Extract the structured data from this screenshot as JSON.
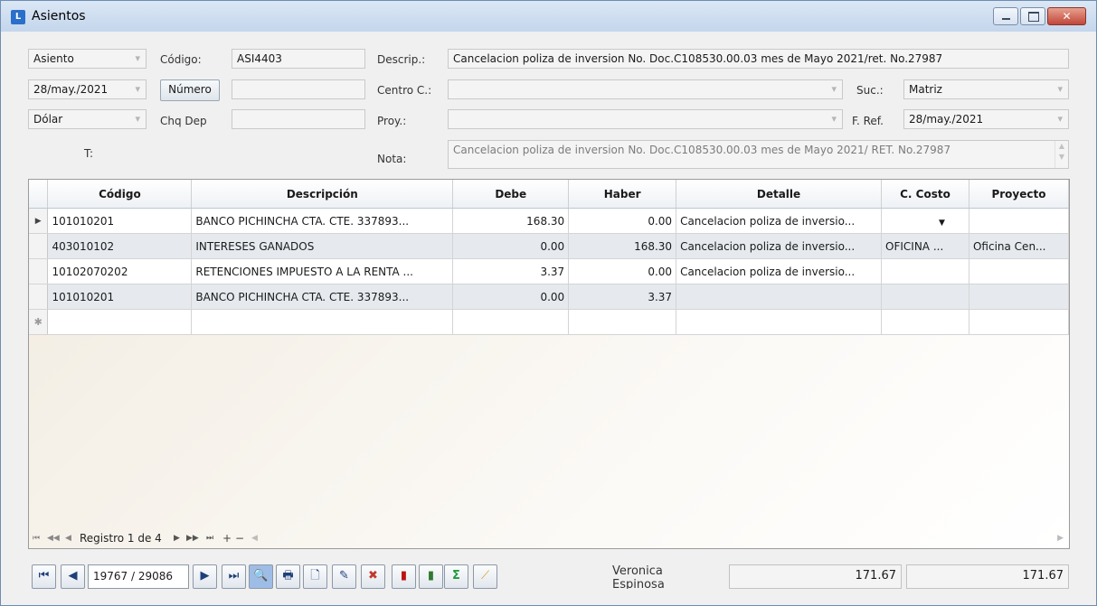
{
  "window": {
    "title": "Asientos",
    "close_glyph": "✕"
  },
  "header": {
    "type_value": "Asiento",
    "codigo_label": "Código:",
    "codigo_value": "ASI4403",
    "descrip_label": "Descrip.:",
    "descrip_value": "Cancelacion poliza de inversion No. Doc.C108530.00.03 mes de Mayo 2021/ret. No.27987",
    "date_value": "28/may./2021",
    "numero_button": "Número",
    "numero_value": "",
    "centro_label": "Centro C.:",
    "centro_value": "",
    "suc_label": "Suc.:",
    "suc_value": "Matriz",
    "currency_value": "Dólar",
    "chq_label": "Chq Dep",
    "chq_value": "",
    "proy_label": "Proy.:",
    "proy_value": "",
    "fref_label": "F. Ref.",
    "fref_value": "28/may./2021",
    "t_label": "T:",
    "nota_label": "Nota:",
    "nota_value": "Cancelacion poliza de inversion No. Doc.C108530.00.03 mes de Mayo 2021/ RET. No.27987"
  },
  "grid": {
    "columns": [
      "Código",
      "Descripción",
      "Debe",
      "Haber",
      "Detalle",
      "C. Costo",
      "Proyecto"
    ],
    "rows": [
      {
        "codigo": "101010201",
        "descripcion": "BANCO PICHINCHA CTA. CTE. 337893...",
        "debe": "168.30",
        "haber": "0.00",
        "detalle": "Cancelacion poliza de inversio...",
        "costo": "",
        "proyecto": ""
      },
      {
        "codigo": "403010102",
        "descripcion": "INTERESES GANADOS",
        "debe": "0.00",
        "haber": "168.30",
        "detalle": "Cancelacion poliza de inversio...",
        "costo": "OFICINA ...",
        "proyecto": "Oficina Cen..."
      },
      {
        "codigo": "10102070202",
        "descripcion": "RETENCIONES IMPUESTO A LA RENTA ...",
        "debe": "3.37",
        "haber": "0.00",
        "detalle": "Cancelacion poliza de inversio...",
        "costo": "",
        "proyecto": ""
      },
      {
        "codigo": "101010201",
        "descripcion": "BANCO PICHINCHA CTA. CTE. 337893...",
        "debe": "0.00",
        "haber": "3.37",
        "detalle": "",
        "costo": "",
        "proyecto": ""
      }
    ],
    "current_row_glyph": "▶",
    "new_row_glyph": "✱",
    "dropdown_glyph": "▼",
    "navigator_text": "Registro 1 de 4"
  },
  "toolbar": {
    "record_position": "19767 / 29086",
    "user_name": "Veronica Espinosa",
    "total_debe": "171.67",
    "total_haber": "171.67"
  }
}
